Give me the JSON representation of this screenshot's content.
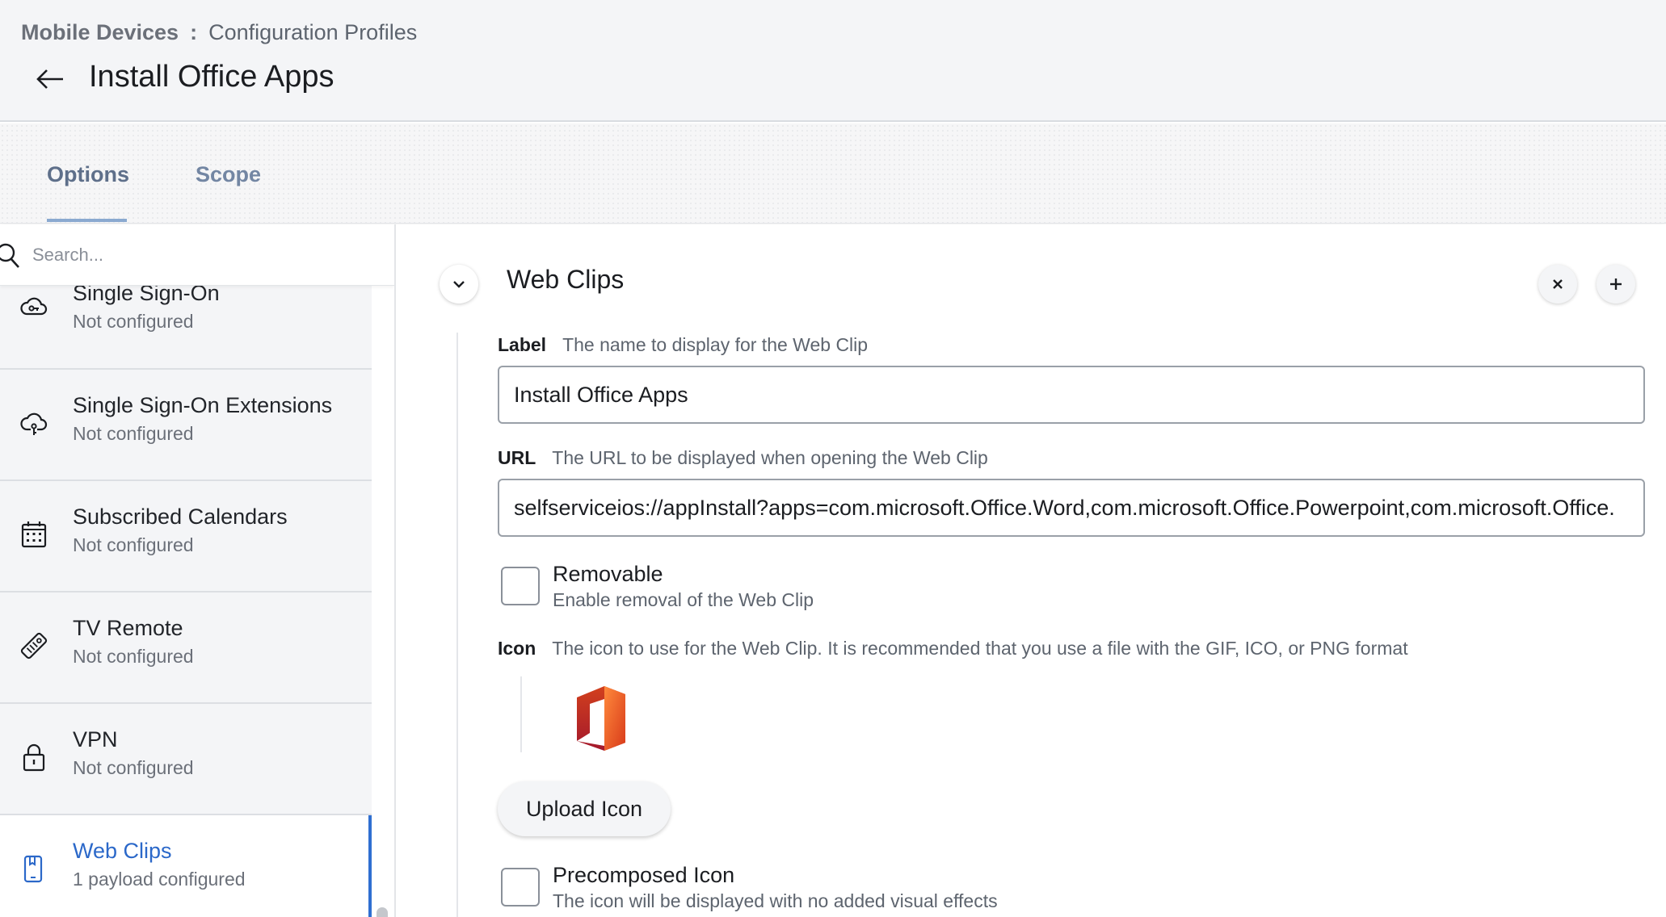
{
  "header": {
    "breadcrumb_root": "Mobile Devices",
    "breadcrumb_separator": ":",
    "breadcrumb_current": "Configuration Profiles",
    "title": "Install Office Apps"
  },
  "tabs": [
    {
      "label": "Options",
      "active": true
    },
    {
      "label": "Scope",
      "active": false
    }
  ],
  "sidebar": {
    "search_placeholder": "Search...",
    "items": [
      {
        "title": "Single Sign-On",
        "status": "Not configured",
        "icon": "cloud-key-icon"
      },
      {
        "title": "Single Sign-On Extensions",
        "status": "Not configured",
        "icon": "cloud-key-icon"
      },
      {
        "title": "Subscribed Calendars",
        "status": "Not configured",
        "icon": "calendar-icon"
      },
      {
        "title": "TV Remote",
        "status": "Not configured",
        "icon": "remote-icon"
      },
      {
        "title": "VPN",
        "status": "Not configured",
        "icon": "lock-icon"
      },
      {
        "title": "Web Clips",
        "status": "1 payload configured",
        "icon": "web-clip-icon",
        "active": true
      }
    ]
  },
  "main": {
    "section_title": "Web Clips",
    "label_field": {
      "name": "Label",
      "description": "The name to display for the Web Clip",
      "value": "Install Office Apps"
    },
    "url_field": {
      "name": "URL",
      "description": "The URL to be displayed when opening the Web Clip",
      "value": "selfserviceios://appInstall?apps=com.microsoft.Office.Word,com.microsoft.Office.Powerpoint,com.microsoft.Office."
    },
    "removable": {
      "title": "Removable",
      "description": "Enable removal of the Web Clip",
      "checked": false
    },
    "icon_field": {
      "name": "Icon",
      "description": "The icon to use for the Web Clip. It is recommended that you use a file with the GIF, ICO, or PNG format"
    },
    "upload_button": "Upload Icon",
    "precomposed": {
      "title": "Precomposed Icon",
      "description": "The icon will be displayed with no added visual effects",
      "checked": false
    }
  },
  "colors": {
    "accent": "#2b68c9",
    "active_border": "#2f6fd1",
    "tab_underline": "#8aa9d0"
  }
}
